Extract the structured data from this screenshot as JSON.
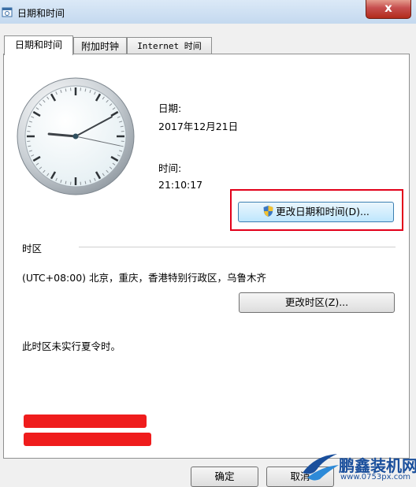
{
  "window": {
    "title": "日期和时间",
    "close_glyph": "x"
  },
  "tabs": [
    {
      "label": "日期和时间",
      "active": true
    },
    {
      "label": "附加时钟",
      "active": false
    },
    {
      "label": "Internet 时间",
      "active": false
    }
  ],
  "clock": {
    "hour": 21,
    "minute": 10,
    "second": 17
  },
  "date": {
    "label": "日期:",
    "value": "2017年12月21日"
  },
  "time": {
    "label": "时间:",
    "value": "21:10:17"
  },
  "change_datetime_button": {
    "text": "更改日期和时间",
    "suffix": "(D)..."
  },
  "timezone": {
    "section_label": "时区",
    "current": "(UTC+08:00) 北京，重庆，香港特别行政区，乌鲁木齐",
    "change_button": {
      "text": "更改时区",
      "suffix": "(Z)..."
    },
    "dst_note": "此时区未实行夏令时。"
  },
  "footer": {
    "ok_label": "确定",
    "cancel_label": "取消"
  },
  "watermark": {
    "site_name": "鹏鑫装机网",
    "url": "www.0753px.com"
  },
  "colors": {
    "highlight": "#e2001a",
    "redaction": "#ef1c1c",
    "watermark": "#1a4f9c"
  }
}
